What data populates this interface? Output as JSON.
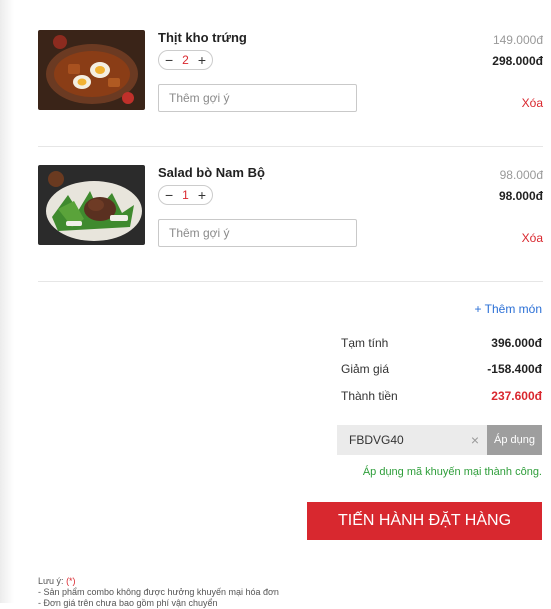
{
  "cart": {
    "items": [
      {
        "name": "Thịt kho trứng",
        "quantity": "2",
        "note_placeholder": "Thêm gợi ý",
        "unit_price": "149.000đ",
        "line_price": "298.000đ",
        "delete_label": "Xóa",
        "decrease_label": "−",
        "increase_label": "+"
      },
      {
        "name": "Salad bò Nam Bộ",
        "quantity": "1",
        "note_placeholder": "Thêm gợi ý",
        "unit_price": "98.000đ",
        "line_price": "98.000đ",
        "delete_label": "Xóa",
        "decrease_label": "−",
        "increase_label": "+"
      }
    ],
    "add_more_label": "+ Thêm món"
  },
  "summary": {
    "subtotal_label": "Tạm tính",
    "subtotal_value": "396.000đ",
    "discount_label": "Giảm giá",
    "discount_value": "-158.400đ",
    "total_label": "Thành tiền",
    "total_value": "237.600đ"
  },
  "coupon": {
    "code": "FBDVG40",
    "clear_icon": "×",
    "apply_label": "Áp dụng",
    "success_message": "Áp dụng mã khuyến mại thành công."
  },
  "checkout": {
    "label": "TIẾN HÀNH ĐẶT HÀNG"
  },
  "notes": {
    "heading": "Lưu ý:",
    "mark": "(*)",
    "lines": [
      "- Sản phẩm combo không được hưởng khuyến mại hóa đơn",
      "- Đơn giá trên chưa bao gồm phí vận chuyển"
    ]
  },
  "colors": {
    "accent_red": "#d8282f",
    "link_blue": "#2a6fd6",
    "success_green": "#2e9e3a",
    "apply_gray": "#9e9e9e"
  }
}
